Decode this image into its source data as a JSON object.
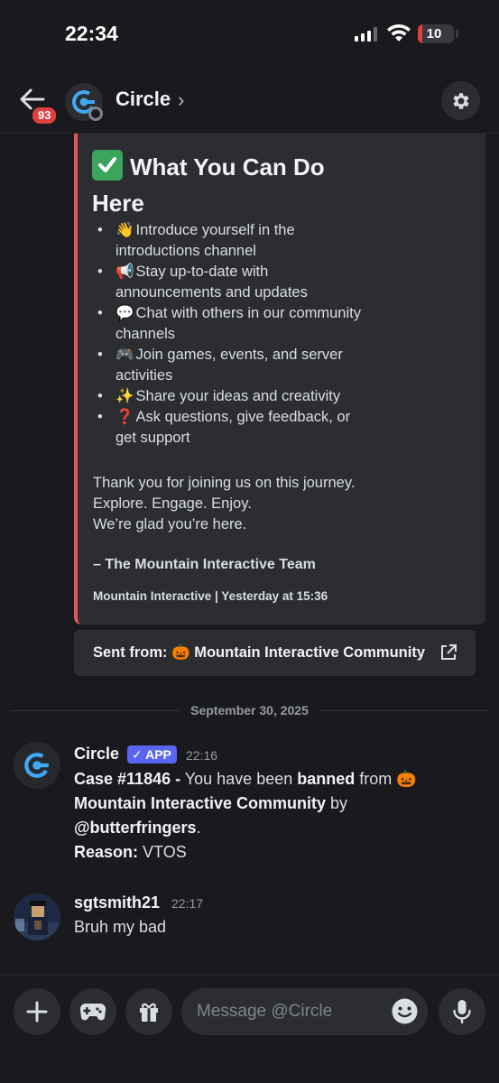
{
  "status_bar": {
    "time": "22:34",
    "battery": "10",
    "battery_level": 0.1
  },
  "header": {
    "back_badge": "93",
    "title": "Circle",
    "chevron": "›"
  },
  "embed": {
    "title": "What You Can Do Here",
    "bullets": [
      {
        "emoji": "👋",
        "text": "Introduce yourself in the introductions channel"
      },
      {
        "emoji": "📢",
        "text": "Stay up-to-date with announcements and updates"
      },
      {
        "emoji": "💬",
        "text": "Chat with others in our community channels"
      },
      {
        "emoji": "🎮",
        "text": "Join games, events, and server activities"
      },
      {
        "emoji": "✨",
        "text": "Share your ideas and creativity"
      },
      {
        "emoji": "❓",
        "text": "Ask questions, give feedback, or get support"
      }
    ],
    "body_line1": "Thank you for joining us on this journey.",
    "body_line2": "Explore. Engage. Enjoy.",
    "body_line3": "We’re glad you’re here.",
    "signature": "– The Mountain Interactive Team",
    "footer": "Mountain Interactive | Yesterday at 15:36"
  },
  "sent_from": {
    "prefix": "Sent from:",
    "emoji": "🎃",
    "server": "Mountain Interactive Community"
  },
  "date_divider": "September 30, 2025",
  "messages": [
    {
      "author": "Circle",
      "tag": "✓ APP",
      "time": "22:16",
      "case": "Case #11846 -",
      "text1": " You have been ",
      "banned": "banned",
      "text2": " from ",
      "emoji": "🎃",
      "server": "Mountain Interactive Community",
      "by": " by",
      "user": "@butterfringers",
      "period": ".",
      "reason_label": "Reason:",
      "reason": " VTOS"
    },
    {
      "author": "sgtsmith21",
      "time": "22:17",
      "text": "Bruh my bad"
    }
  ],
  "composer": {
    "placeholder": "Message @Circle"
  },
  "icons": [
    "back-arrow-icon",
    "gear-icon",
    "external-link-icon",
    "plus-icon",
    "gamepad-icon",
    "gift-icon",
    "emoji-icon",
    "microphone-icon"
  ],
  "colors": {
    "background": "#1a1a1e",
    "embed_accent": "#e0575b",
    "app_tag": "#5865f2",
    "badge": "#e0403f"
  }
}
